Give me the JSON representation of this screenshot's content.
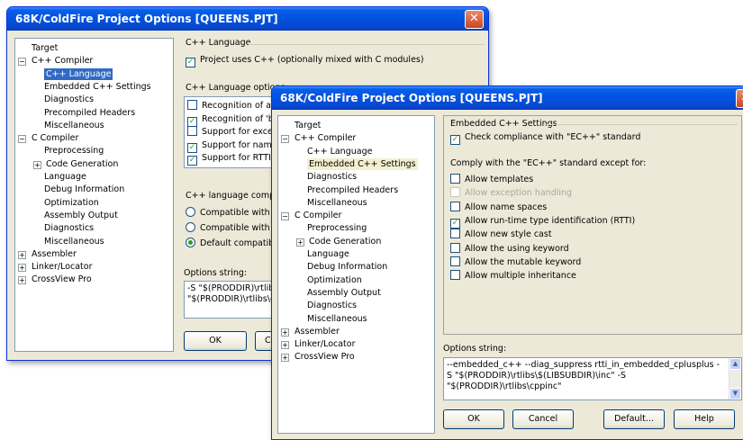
{
  "back_window": {
    "title": "68K/ColdFire Project Options [QUEENS.PJT]",
    "tree": [
      {
        "label": "Target",
        "level": 0,
        "expander": ""
      },
      {
        "label": "C++ Compiler",
        "level": 0,
        "expander": "−"
      },
      {
        "label": "C++ Language",
        "level": 1,
        "expander": "",
        "state": "selected"
      },
      {
        "label": "Embedded C++ Settings",
        "level": 1,
        "expander": ""
      },
      {
        "label": "Diagnostics",
        "level": 1,
        "expander": ""
      },
      {
        "label": "Precompiled Headers",
        "level": 1,
        "expander": ""
      },
      {
        "label": "Miscellaneous",
        "level": 1,
        "expander": ""
      },
      {
        "label": "C Compiler",
        "level": 0,
        "expander": "−"
      },
      {
        "label": "Preprocessing",
        "level": 1,
        "expander": ""
      },
      {
        "label": "Code Generation",
        "level": 1,
        "expander": "+"
      },
      {
        "label": "Language",
        "level": 1,
        "expander": ""
      },
      {
        "label": "Debug Information",
        "level": 1,
        "expander": ""
      },
      {
        "label": "Optimization",
        "level": 1,
        "expander": ""
      },
      {
        "label": "Assembly Output",
        "level": 1,
        "expander": ""
      },
      {
        "label": "Diagnostics",
        "level": 1,
        "expander": ""
      },
      {
        "label": "Miscellaneous",
        "level": 1,
        "expander": ""
      },
      {
        "label": "Assembler",
        "level": 0,
        "expander": "+"
      },
      {
        "label": "Linker/Locator",
        "level": 0,
        "expander": "+"
      },
      {
        "label": "CrossView Pro",
        "level": 0,
        "expander": "+"
      }
    ],
    "group_title": "C++ Language",
    "uses_cpp_label": "Project uses C++ (optionally mixed with C modules)",
    "options_label": "C++ Language options",
    "options": [
      {
        "label": "Recognition of alte",
        "checked": false
      },
      {
        "label": "Recognition of 'boo",
        "checked": true
      },
      {
        "label": "Support for excepti",
        "checked": false
      },
      {
        "label": "Support for namesp",
        "checked": true
      },
      {
        "label": "Support for RTTI (r",
        "checked": true
      }
    ],
    "compat_label": "C++ language compati",
    "compat": [
      {
        "label": "Compatible with cfr",
        "selected": false
      },
      {
        "label": "Compatible with cfr",
        "selected": false
      },
      {
        "label": "Default compatibilit",
        "selected": true
      }
    ],
    "options_string_label": "Options string:",
    "options_string": "-S \"$(PRODDIR)\\rtlibs\\$(LIBSUBDIR)\\inc\" -S \"$(PRODDIR)\\rtlibs\\cppinc\"",
    "ok": "OK",
    "cancel_partial": "C"
  },
  "front_window": {
    "title": "68K/ColdFire Project Options [QUEENS.PJT]",
    "tree": [
      {
        "label": "Target",
        "level": 0,
        "expander": ""
      },
      {
        "label": "C++ Compiler",
        "level": 0,
        "expander": "−"
      },
      {
        "label": "C++ Language",
        "level": 1,
        "expander": ""
      },
      {
        "label": "Embedded C++ Settings",
        "level": 1,
        "expander": "",
        "state": "highlighted"
      },
      {
        "label": "Diagnostics",
        "level": 1,
        "expander": ""
      },
      {
        "label": "Precompiled Headers",
        "level": 1,
        "expander": ""
      },
      {
        "label": "Miscellaneous",
        "level": 1,
        "expander": ""
      },
      {
        "label": "C Compiler",
        "level": 0,
        "expander": "−"
      },
      {
        "label": "Preprocessing",
        "level": 1,
        "expander": ""
      },
      {
        "label": "Code Generation",
        "level": 1,
        "expander": "+"
      },
      {
        "label": "Language",
        "level": 1,
        "expander": ""
      },
      {
        "label": "Debug Information",
        "level": 1,
        "expander": ""
      },
      {
        "label": "Optimization",
        "level": 1,
        "expander": ""
      },
      {
        "label": "Assembly Output",
        "level": 1,
        "expander": ""
      },
      {
        "label": "Diagnostics",
        "level": 1,
        "expander": ""
      },
      {
        "label": "Miscellaneous",
        "level": 1,
        "expander": ""
      },
      {
        "label": "Assembler",
        "level": 0,
        "expander": "+"
      },
      {
        "label": "Linker/Locator",
        "level": 0,
        "expander": "+"
      },
      {
        "label": "CrossView Pro",
        "level": 0,
        "expander": "+"
      }
    ],
    "group_title": "Embedded C++ Settings",
    "check_compliance": {
      "label": "Check compliance with \"EC++\" standard",
      "checked": true
    },
    "except_label": "Comply with the \"EC++\" standard except for:",
    "exceptions": [
      {
        "label": "Allow templates",
        "checked": false,
        "disabled": false
      },
      {
        "label": "Allow exception handling",
        "checked": false,
        "disabled": true
      },
      {
        "label": "Allow name spaces",
        "checked": false,
        "disabled": false
      },
      {
        "label": "Allow run-time type identification (RTTI)",
        "checked": true,
        "disabled": false
      },
      {
        "label": "Allow new style cast",
        "checked": false,
        "disabled": false
      },
      {
        "label": "Allow the using keyword",
        "checked": false,
        "disabled": false
      },
      {
        "label": "Allow the mutable keyword",
        "checked": false,
        "disabled": false
      },
      {
        "label": "Allow multiple inheritance",
        "checked": false,
        "disabled": false
      }
    ],
    "options_string_label": "Options string:",
    "options_string": "--embedded_c++ --diag_suppress rtti_in_embedded_cplusplus -S \"$(PRODDIR)\\rtlibs\\$(LIBSUBDIR)\\inc\" -S \"$(PRODDIR)\\rtlibs\\cppinc\"",
    "ok": "OK",
    "cancel": "Cancel",
    "default": "Default...",
    "help": "Help"
  },
  "glyphs": {
    "close": "✕",
    "check": "✓",
    "up": "▲",
    "down": "▼"
  },
  "colors": {
    "title_blue": "#0052df",
    "selection": "#316ac5",
    "close_red": "#c9461f"
  }
}
